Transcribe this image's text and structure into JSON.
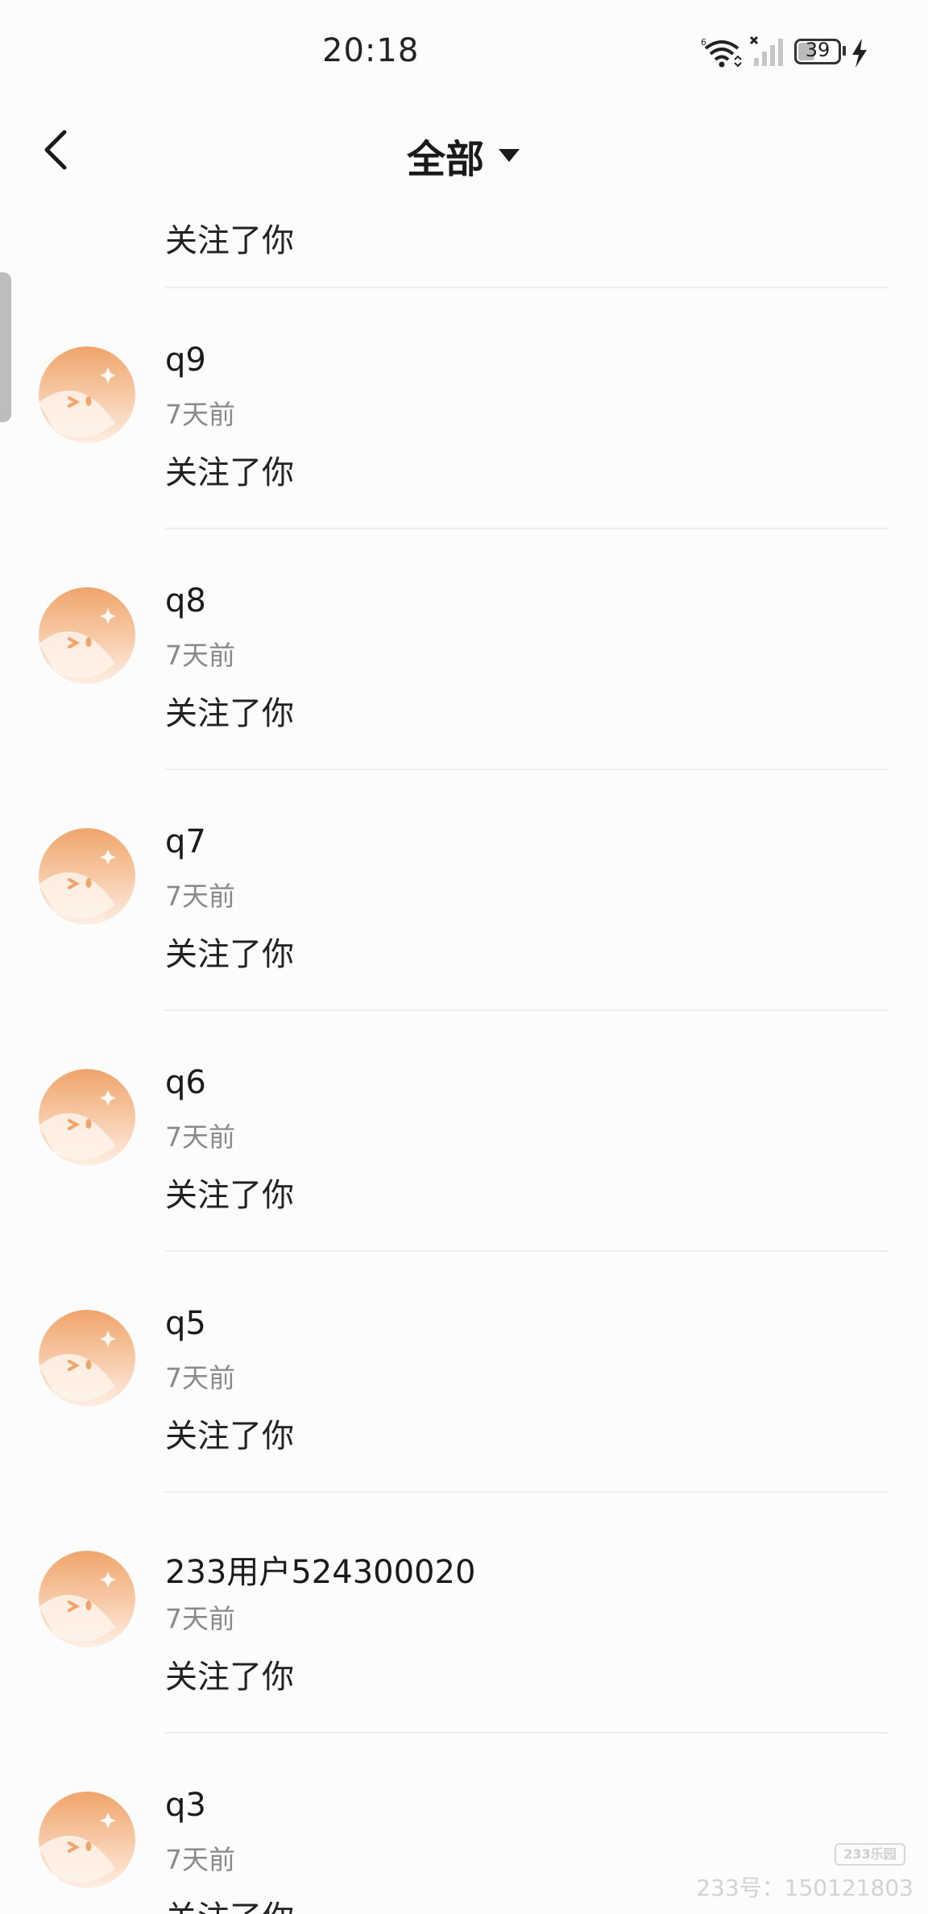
{
  "status_bar": {
    "time": "20:18",
    "battery": "39"
  },
  "header": {
    "title": "全部"
  },
  "list": {
    "partial_top_message": "关注了你",
    "items": [
      {
        "name": "q9",
        "time": "7天前",
        "message": "关注了你"
      },
      {
        "name": "q8",
        "time": "7天前",
        "message": "关注了你"
      },
      {
        "name": "q7",
        "time": "7天前",
        "message": "关注了你"
      },
      {
        "name": "q6",
        "time": "7天前",
        "message": "关注了你"
      },
      {
        "name": "q5",
        "time": "7天前",
        "message": "关注了你"
      },
      {
        "name": "233用户524300020",
        "time": "7天前",
        "message": "关注了你"
      },
      {
        "name": "q3",
        "time": "7天前",
        "message": "关注了你"
      }
    ]
  },
  "watermark": {
    "logo": "233乐园",
    "text": "233号：150121803"
  },
  "colors": {
    "avatar_top": "#f0a46a",
    "avatar_bottom": "#fdeee2",
    "divider": "#efeded",
    "secondary_text": "#8a8a8a"
  }
}
